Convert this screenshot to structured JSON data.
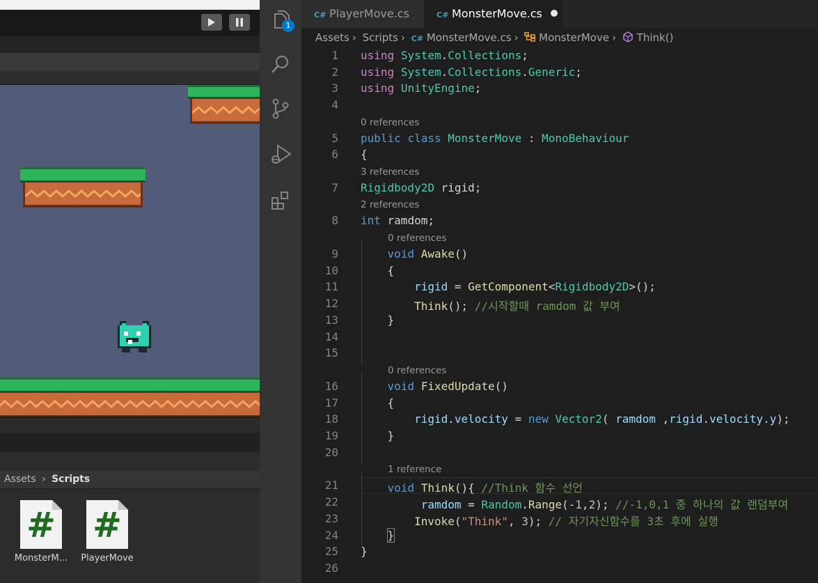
{
  "unity": {
    "breadcrumb": {
      "root": "Assets",
      "current": "Scripts"
    },
    "assets": [
      {
        "label": "MonsterM...",
        "glyph": "#"
      },
      {
        "label": "PlayerMove",
        "glyph": "#"
      }
    ]
  },
  "activity_bar": {
    "explorer_badge": "1"
  },
  "tabs": [
    {
      "label": "PlayerMove.cs",
      "icon": "C#"
    },
    {
      "label": "MonsterMove.cs",
      "icon": "C#"
    }
  ],
  "breadcrumbs": [
    "Assets",
    "Scripts",
    "MonsterMove.cs",
    "MonsterMove",
    "Think()"
  ],
  "code": {
    "line_numbers": [
      "1",
      "2",
      "3",
      "4",
      "5",
      "6",
      "7",
      "8",
      "9",
      "10",
      "11",
      "12",
      "13",
      "14",
      "15",
      "16",
      "17",
      "18",
      "19",
      "20",
      "21",
      "22",
      "23",
      "24",
      "25",
      "26"
    ],
    "codelens": {
      "class": "0 references",
      "rigid": "3 references",
      "ramdom": "2 references",
      "awake": "0 references",
      "fixedupdate": "0 references",
      "think": "1 reference"
    }
  },
  "colors": {
    "keyword": "#569cd6",
    "control_keyword": "#c586c0",
    "type": "#4ec9b0",
    "function": "#dcdcaa",
    "variable": "#9cdcfe",
    "number": "#b5cea8",
    "string": "#ce9178",
    "comment": "#6a9955",
    "badge": "#007acc"
  }
}
